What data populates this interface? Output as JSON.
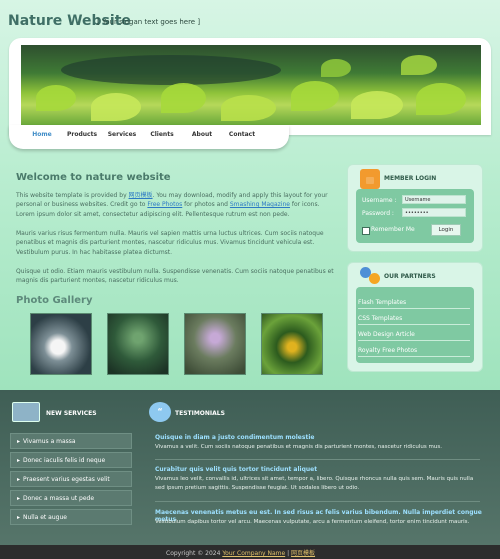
{
  "header": {
    "site_name": "Nature Website",
    "slogan": "[ Your slogan text goes here ]"
  },
  "nav": {
    "items": [
      "Home",
      "Products",
      "Services",
      "Clients",
      "About",
      "Contact"
    ],
    "active": "Home"
  },
  "main": {
    "welcome_title": "Welcome to nature website",
    "para1_a": "This website template is provided by ",
    "para1_link1": "网页模板",
    "para1_b": ". You may download, modify and apply this layout for your personal or business websites. Credit go to ",
    "para1_link2": "Free Photos",
    "para1_c": " for photos and ",
    "para1_link3": "Smashing Magazine",
    "para1_d": " for icons. Lorem ipsum dolor sit amet, consectetur adipiscing elit. Pellentesque rutrum est non pede.",
    "para2": "Mauris varius risus fermentum nulla. Mauris vel sapien mattis urna luctus ultrices. Cum sociis natoque penatibus et magnis dis parturient montes, nascetur ridiculus mus. Vivamus tincidunt vehicula est. Vestibulum purus. In hac habitasse platea dictumst.",
    "para3": "Quisque ut odio. Etiam mauris vestibulum nulla. Suspendisse venenatis. Cum sociis natoque penatibus et magnis dis parturient montes, nascetur ridiculus mus.",
    "gallery_title": "Photo Gallery"
  },
  "login": {
    "title": "MEMBER LOGIN",
    "username_label": "Username :",
    "username_value": "Username",
    "password_label": "Password :",
    "password_value": "••••••••",
    "remember_label": "Remember Me",
    "login_button": "Login"
  },
  "partners": {
    "title": "OUR PARTNERS",
    "links": [
      "Flash Templates",
      "CSS Templates",
      "Web Design Article",
      "Royalty Free Photos"
    ]
  },
  "services": {
    "title": "NEW SERVICES",
    "items": [
      "Vivamus a massa",
      "Donec iaculis felis id neque",
      "Praesent varius egestas velit",
      "Donec a massa ut pede",
      "Nulla et augue"
    ]
  },
  "testimonials": {
    "title": "TESTIMONIALS",
    "items": [
      {
        "title": "Quisque in diam a justo condimentum molestie",
        "body": "Vivamus a velit. Cum sociis natoque penatibus et magnis dis parturient montes, nascetur ridiculus mus."
      },
      {
        "title": "Curabitur quis velit quis tortor tincidunt aliquet",
        "body": "Vivamus leo velit, convallis id, ultrices sit amet, tempor a, libero. Quisque rhoncus nulla quis sem. Mauris quis nulla sed ipsum pretium sagittis. Suspendisse feugiat. Ut sodales libero ut odio."
      },
      {
        "title": "Maecenas venenatis metus eu est. In sed risus ac felis varius bibendum. Nulla imperdiet congue metus",
        "body": "Vestibulum dapibus tortor vel arcu. Maecenas vulputate, arcu a fermentum eleifend, tortor enim tincidunt mauris."
      }
    ]
  },
  "footer": {
    "copyright": "Copyright © 2024 ",
    "company": "Your Company Name",
    "sep": " | ",
    "designer": "网页模板"
  }
}
